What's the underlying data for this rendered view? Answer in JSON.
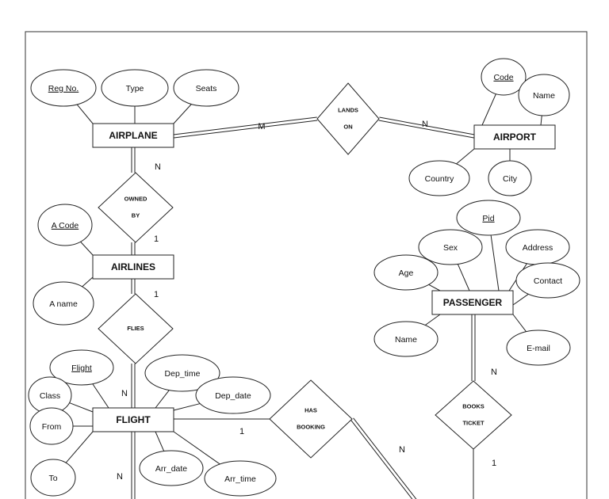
{
  "entities": {
    "airplane": "AIRPLANE",
    "airport": "AIRPORT",
    "airlines": "AIRLINES",
    "passenger": "PASSENGER",
    "flight": "FLIGHT"
  },
  "relationships": {
    "lands_on": [
      "LANDS",
      "ON"
    ],
    "owned_by": [
      "OWNED",
      "BY"
    ],
    "flies": [
      "FLIES"
    ],
    "has_booking": [
      "HAS",
      "BOOKING"
    ],
    "books_ticket": [
      "BOOKS",
      "TICKET"
    ]
  },
  "attributes": {
    "reg_no": "Reg No.",
    "type": "Type",
    "seats": "Seats",
    "code": "Code",
    "airport_name": "Name",
    "country": "Country",
    "city": "City",
    "pid": "Pid",
    "sex": "Sex",
    "address": "Address",
    "age": "Age",
    "contact": "Contact",
    "passenger_name": "Name",
    "email": "E-mail",
    "a_code": "A Code",
    "a_name": "A name",
    "flight": "Flight",
    "dep_time": "Dep_time",
    "dep_date": "Dep_date",
    "class": "Class",
    "from": "From",
    "to": "To",
    "arr_date": "Arr_date",
    "arr_time": "Arr_time"
  },
  "primary_keys": [
    "reg_no",
    "code",
    "pid",
    "a_code",
    "flight"
  ],
  "cardinalities": {
    "airplane_lands": "M",
    "airport_lands": "N",
    "airplane_owned": "N",
    "airlines_owned": "1",
    "airlines_flies": "1",
    "flight_flies": "N",
    "flight_below": "N",
    "flight_booking": "1",
    "booking_other": "N",
    "passenger_books": "N",
    "books_below": "1"
  }
}
